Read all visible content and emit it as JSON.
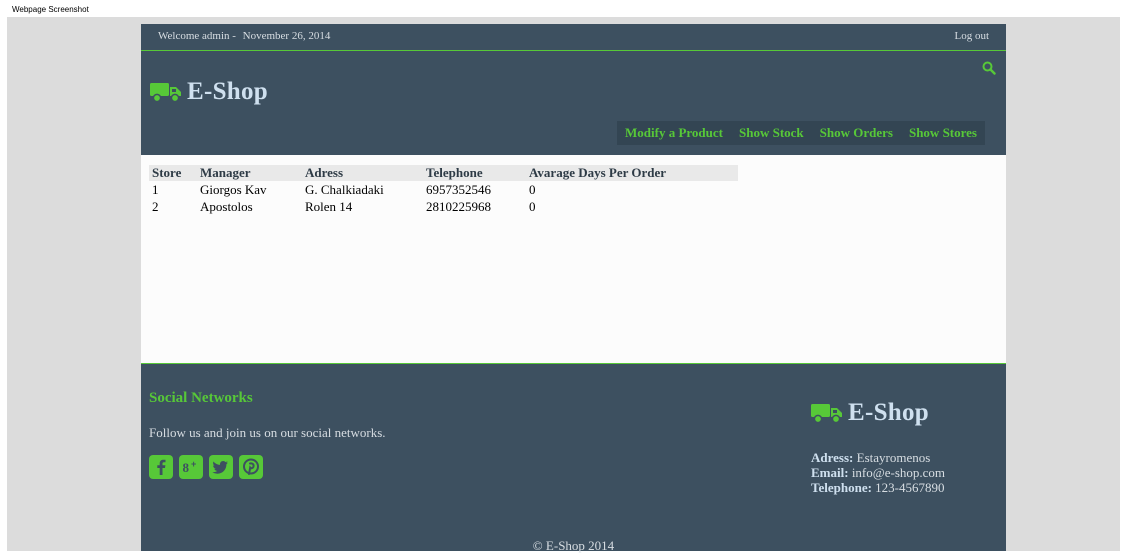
{
  "screenshot_label": "Webpage Screenshot",
  "topbar": {
    "welcome": "Welcome admin -",
    "date": "November 26, 2014",
    "logout": "Log out"
  },
  "header": {
    "brand": "E-Shop",
    "nav": [
      "Modify a Product",
      "Show Stock",
      "Show Orders",
      "Show Stores"
    ]
  },
  "table": {
    "headers": [
      "Store",
      "Manager",
      "Adress",
      "Telephone",
      "Avarage Days Per Order"
    ],
    "rows": [
      [
        "1",
        "Giorgos Kav",
        "G. Chalkiadaki",
        "6957352546",
        "0"
      ],
      [
        "2",
        "Apostolos",
        "Rolen 14",
        "2810225968",
        "0"
      ]
    ]
  },
  "footer": {
    "social_title": "Social Networks",
    "social_text": "Follow us and join us on our social networks.",
    "social_icons": [
      "facebook-icon",
      "google-plus-icon",
      "twitter-icon",
      "pinterest-icon"
    ],
    "brand": "E-Shop",
    "contact": [
      {
        "label": "Adress:",
        "value": "Estayromenos"
      },
      {
        "label": "Email:",
        "value": "info@e-shop.com"
      },
      {
        "label": "Telephone:",
        "value": "123-4567890"
      }
    ],
    "copyright": "© E-Shop 2014"
  },
  "colors": {
    "accent": "#57c838",
    "header_bg": "#3d5060",
    "brand_text": "#cfe0ef",
    "content_bg": "#fcfcfc"
  }
}
